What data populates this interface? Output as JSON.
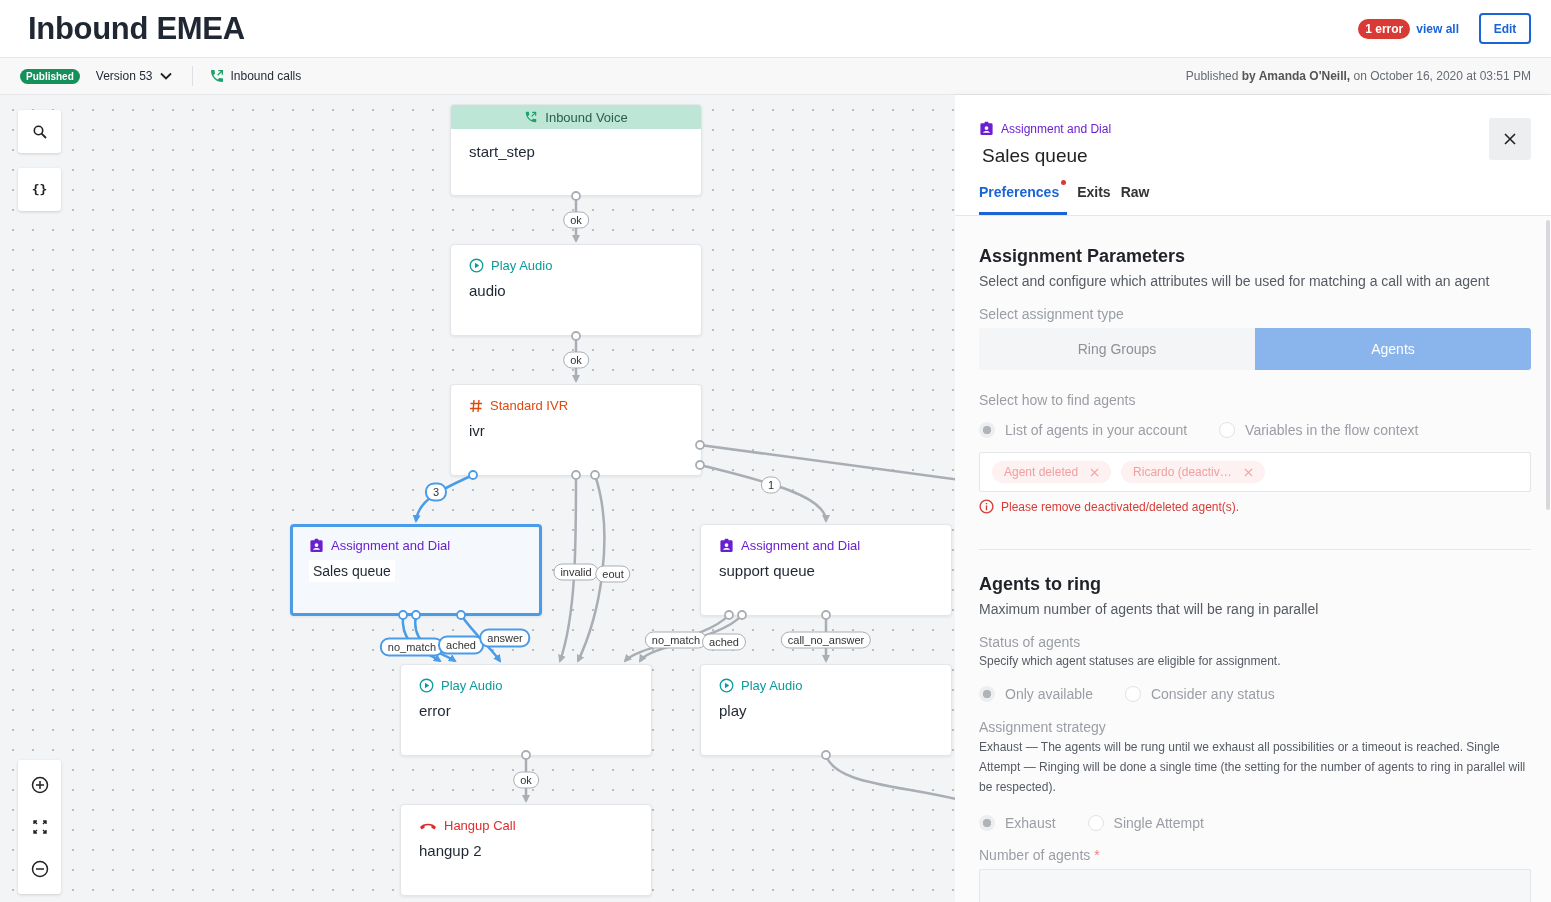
{
  "header": {
    "title": "Inbound EMEA",
    "error_badge": "1 error",
    "view_all": "view all",
    "edit_button": "Edit"
  },
  "subbar": {
    "status": "Published",
    "version": "Version 53",
    "flow_type": "Inbound calls",
    "published_info": "Published **by Amanda O'Neill,** on October 16, 2020 at 03:51 PM"
  },
  "canvas": {
    "tools": [
      {
        "kind": "search"
      },
      {
        "kind": "variables",
        "label": "{}"
      }
    ],
    "zoom_controls": [
      {
        "kind": "zoom_in"
      },
      {
        "kind": "fit"
      },
      {
        "kind": "zoom_out"
      }
    ],
    "nodes": [
      {
        "kind": "inbound_voice",
        "type": "Inbound Voice",
        "name": "start_step",
        "selected": false
      },
      {
        "kind": "play_audio",
        "type": "Play Audio",
        "name": "audio",
        "selected": false
      },
      {
        "kind": "ivr",
        "type": "Standard IVR",
        "name": "ivr",
        "selected": false
      },
      {
        "kind": "assignment",
        "type": "Assignment and Dial",
        "name": "Sales queue",
        "selected": true
      },
      {
        "kind": "assignment",
        "type": "Assignment and Dial",
        "name": "support queue",
        "selected": false
      },
      {
        "kind": "play_audio",
        "type": "Play Audio",
        "name": "error",
        "selected": false
      },
      {
        "kind": "play_audio",
        "type": "Play Audio",
        "name": "play",
        "selected": false
      },
      {
        "kind": "hangup",
        "type": "Hangup Call",
        "name": "hangup 2",
        "selected": false
      }
    ],
    "edges": [
      {
        "label": "ok",
        "selected": false
      },
      {
        "label": "ok",
        "selected": false
      },
      {
        "label": "3",
        "selected": true
      },
      {
        "label": "1",
        "selected": false
      },
      {
        "selected": false
      },
      {
        "label": "invalid",
        "selected": false
      },
      {
        "label": "eout",
        "selected": false
      },
      {
        "label": "no_match",
        "selected": true
      },
      {
        "label": "ached",
        "selected": true
      },
      {
        "label": "answer",
        "selected": true
      },
      {
        "label": "no_match",
        "selected": false
      },
      {
        "label": "ached",
        "selected": false
      },
      {
        "label": "call_no_answer",
        "selected": false
      },
      {
        "label": "ok",
        "selected": false
      },
      {
        "selected": false
      }
    ]
  },
  "panel": {
    "node_type": "Assignment and Dial",
    "title": "Sales queue",
    "tabs": [
      {
        "label": "Preferences",
        "selected": true,
        "has_error": true
      },
      {
        "label": "Exits",
        "selected": false,
        "has_error": false
      },
      {
        "label": "Raw",
        "selected": false,
        "has_error": false
      }
    ],
    "assignment": {
      "heading": "Assignment Parameters",
      "description": "Select and configure which attributes will be used for matching a call with an agent",
      "type_label": "Select assignment type",
      "type_options": [
        {
          "label": "Ring Groups",
          "selected": false
        },
        {
          "label": "Agents",
          "selected": true
        }
      ],
      "find_label": "Select how to find agents",
      "find_options": [
        {
          "label": "List of agents in your account",
          "selected": true
        },
        {
          "label": "Variables in the flow context",
          "selected": false
        }
      ],
      "agents": [
        {
          "label": "Agent deleted"
        },
        {
          "label": "Ricardo (deactiv…"
        }
      ],
      "error": "Please remove deactivated/deleted agent(s)."
    },
    "agents_to_ring": {
      "heading": "Agents to ring",
      "description": "Maximum number of agents that will be rang in parallel",
      "status_label": "Status of agents",
      "status_hint": "Specify which agent statuses are eligible for assignment.",
      "status_options": [
        {
          "label": "Only available",
          "selected": true
        },
        {
          "label": "Consider any status",
          "selected": false
        }
      ],
      "strategy_label": "Assignment strategy",
      "strategy_hint": "Exhaust — The agents will be rung until we exhaust all possibilities or a timeout is reached. Single Attempt — Ringing will be done a single time (the setting for the number of agents to ring in parallel will be respected).",
      "strategy_options": [
        {
          "label": "Exhaust",
          "selected": true
        },
        {
          "label": "Single Attempt",
          "selected": false
        }
      ],
      "count_label": "Number of agents",
      "required_mark": "*"
    }
  }
}
